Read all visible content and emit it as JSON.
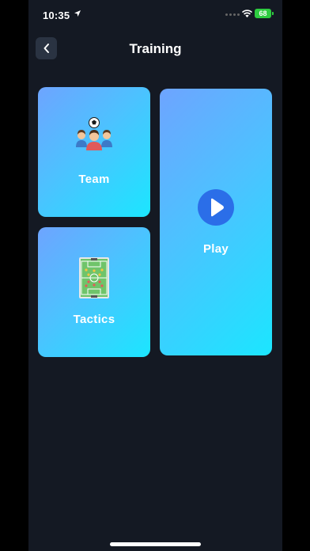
{
  "status_bar": {
    "time": "10:35",
    "battery": "68"
  },
  "header": {
    "title": "Training"
  },
  "cards": {
    "team": {
      "label": "Team"
    },
    "tactics": {
      "label": "Tactics"
    },
    "play": {
      "label": "Play"
    }
  },
  "colors": {
    "background": "#141923",
    "card_gradient_start": "#6ea4ff",
    "card_gradient_end": "#1be6ff",
    "play_button": "#2b6ee8",
    "battery": "#2ecc40"
  },
  "icons": [
    "back-chevron-icon",
    "location-arrow-icon",
    "wifi-icon",
    "team-players-icon",
    "football-field-icon",
    "play-circle-icon"
  ]
}
